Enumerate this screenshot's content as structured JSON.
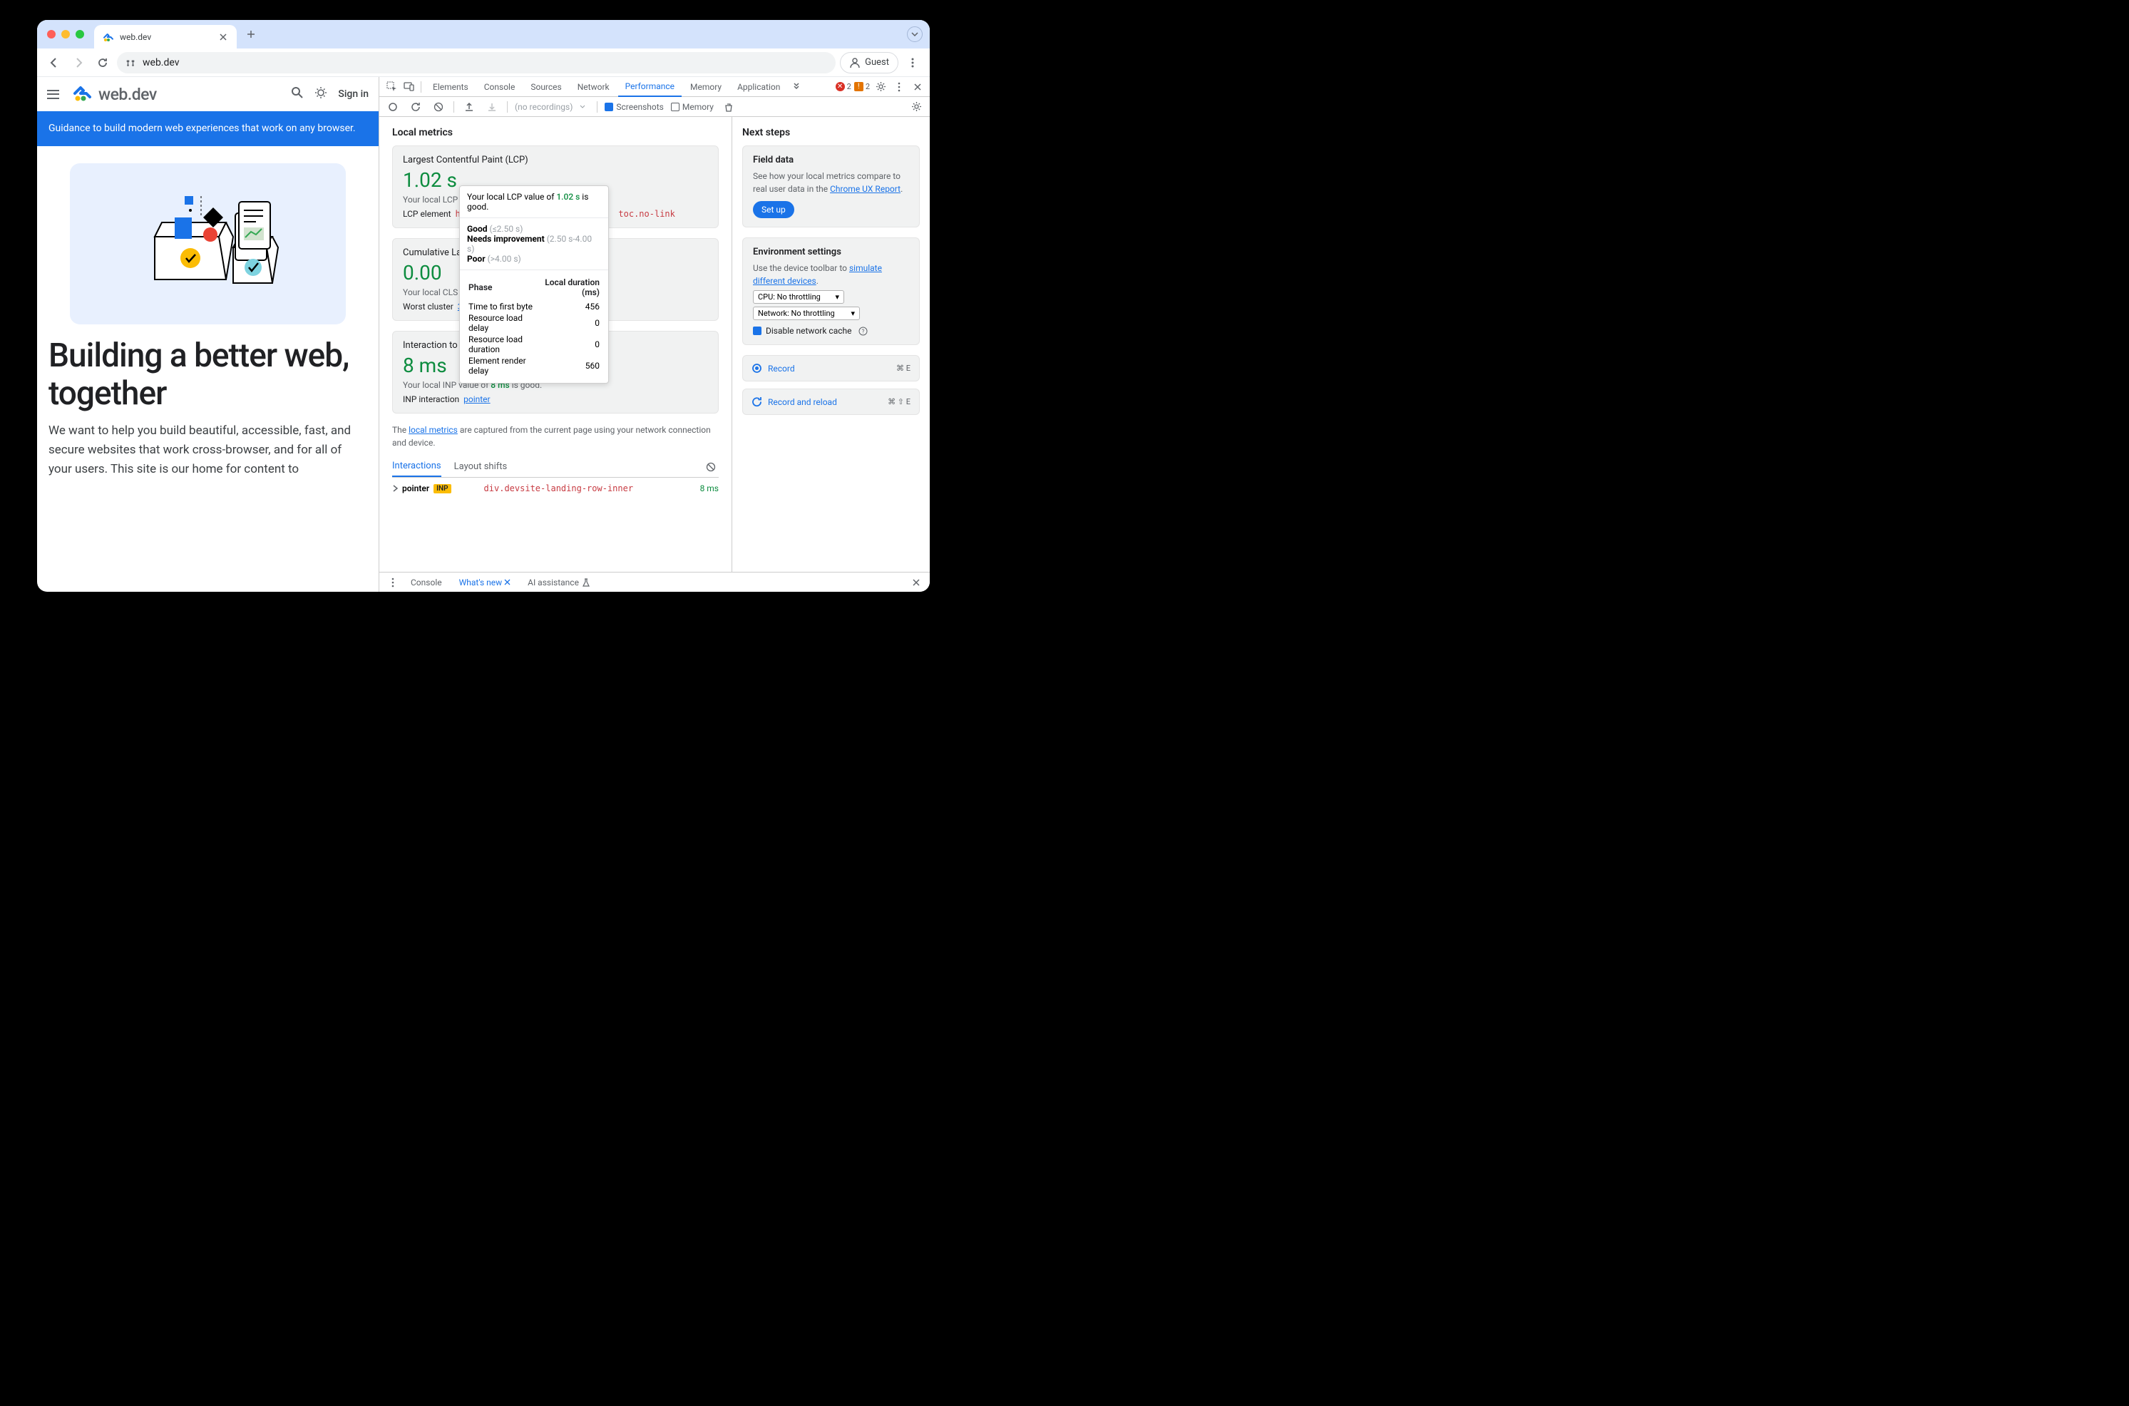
{
  "chrome": {
    "tab_title": "web.dev",
    "url": "web.dev",
    "guest_label": "Guest"
  },
  "page": {
    "wordmark": "web.dev",
    "sign_in": "Sign in",
    "banner": "Guidance to build modern web experiences that work on any browser.",
    "hero_title": "Building a better web, together",
    "hero_body": "We want to help you build beautiful, accessible, fast, and secure websites that work cross-browser, and for all of your users. This site is our home for content to"
  },
  "devtools": {
    "tabs": [
      "Elements",
      "Console",
      "Sources",
      "Network",
      "Performance",
      "Memory",
      "Application"
    ],
    "active_tab": "Performance",
    "errors": "2",
    "warnings": "2",
    "subbar": {
      "recordings": "(no recordings)",
      "screenshots_label": "Screenshots",
      "memory_label": "Memory"
    },
    "local_metrics_title": "Local metrics",
    "lcp": {
      "name": "Largest Contentful Paint (LCP)",
      "value": "1.02 s",
      "desc_prefix": "Your local LCP valu",
      "el_label": "LCP element",
      "el_prefix": "h3#b",
      "el_suffix": "toc.no-link"
    },
    "cls": {
      "name": "Cumulative Layo",
      "value": "0.00",
      "desc": "Your local CLS valu",
      "worst_label": "Worst cluster",
      "worst_link": "3 shifts"
    },
    "inp": {
      "name": "Interaction to Next Paint (INP)",
      "value": "8 ms",
      "desc_prefix": "Your local INP value of ",
      "desc_val": "8 ms",
      "desc_suffix": " is good.",
      "el_label": "INP interaction",
      "el_link": "pointer"
    },
    "note_prefix": "The ",
    "note_link": "local metrics",
    "note_suffix": " are captured from the current page using your network connection and device.",
    "mini_tabs": {
      "interactions": "Interactions",
      "layout_shifts": "Layout shifts"
    },
    "interaction_row": {
      "type": "pointer",
      "badge": "INP",
      "el": "div.devsite-landing-row-inner",
      "time": "8 ms"
    },
    "popover": {
      "line1_prefix": "Your local LCP value of ",
      "line1_val": "1.02 s",
      "line1_suffix": " is good.",
      "good": "Good",
      "good_range": "(≤2.50 s)",
      "ni": "Needs improvement",
      "ni_range": "(2.50 s-4.00 s)",
      "poor": "Poor",
      "poor_range": "(>4.00 s)",
      "phase_h": "Phase",
      "dur_h": "Local duration (ms)",
      "rows": [
        {
          "phase": "Time to first byte",
          "dur": "456"
        },
        {
          "phase": "Resource load delay",
          "dur": "0"
        },
        {
          "phase": "Resource load duration",
          "dur": "0"
        },
        {
          "phase": "Element render delay",
          "dur": "560"
        }
      ]
    },
    "next_steps_title": "Next steps",
    "field_data": {
      "title": "Field data",
      "body_prefix": "See how your local metrics compare to real user data in the ",
      "body_link": "Chrome UX Report",
      "setup": "Set up"
    },
    "env": {
      "title": "Environment settings",
      "body_prefix": "Use the device toolbar to ",
      "body_link": "simulate different devices",
      "cpu": "CPU: No throttling",
      "net": "Network: No throttling",
      "cache": "Disable network cache"
    },
    "record": "Record",
    "record_kbd": "⌘ E",
    "record_reload": "Record and reload",
    "record_reload_kbd": "⌘ ⇧ E",
    "drawer": {
      "console": "Console",
      "whatsnew": "What's new",
      "ai": "AI assistance"
    }
  }
}
